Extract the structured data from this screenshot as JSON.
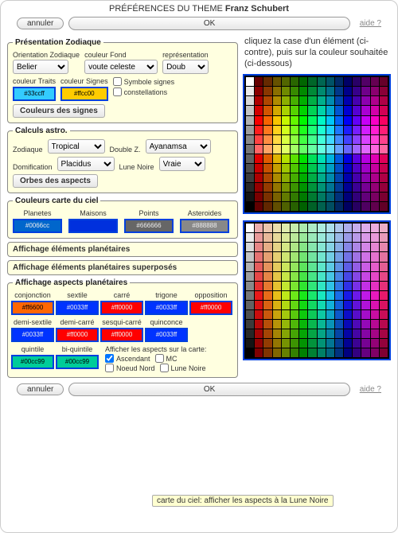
{
  "window_title_prefix": "PRÉFÉRENCES DU THEME",
  "window_title_name": "Franz Schubert",
  "buttons": {
    "cancel": "annuler",
    "ok": "OK",
    "help": "aide ?"
  },
  "zodiac": {
    "legend": "Présentation Zodiaque",
    "orientation_label": "Orientation Zodiaque",
    "orientation_value": "Belier",
    "bgcolor_label": "couleur Fond",
    "bgcolor_value": "voute celeste",
    "repr_label": "représentation",
    "repr_value": "Doub",
    "traits_label": "couleur Traits",
    "traits_hex": "#33ccff",
    "signs_label": "couleur Signes",
    "signs_hex": "#ffcc00",
    "sym_label": "Symbole signes",
    "const_label": "constellations",
    "signs_button": "Couleurs des signes"
  },
  "calc": {
    "legend": "Calculs astro.",
    "zodiac_label": "Zodiaque",
    "zodiac_value": "Tropical",
    "doublez_label": "Double Z.",
    "doublez_value": "Ayanamsa",
    "dom_label": "Domification",
    "dom_value": "Placidus",
    "lune_label": "Lune Noire",
    "lune_value": "Vraie",
    "orbes_button": "Orbes des aspects"
  },
  "sky": {
    "legend": "Couleurs carte du ciel",
    "items": [
      {
        "label": "Planetes",
        "hex": "#0066cc",
        "bg": "#0066cc",
        "dark": true
      },
      {
        "label": "Maisons",
        "hex": "",
        "bg": "#0030dd",
        "dark": true
      },
      {
        "label": "Points",
        "hex": "#666666",
        "bg": "#666666",
        "dark": true
      },
      {
        "label": "Asteroides",
        "hex": "#888888",
        "bg": "#888888",
        "dark": true
      }
    ]
  },
  "banners": {
    "aff_planets": "Affichage éléments planétaires",
    "aff_superposed": "Affichage éléments planétaires superposés"
  },
  "aspects": {
    "legend": "Affichage aspects planétaires",
    "row1": [
      {
        "label": "conjonction",
        "hex": "#ff6600",
        "bg": "#ff6600"
      },
      {
        "label": "sextile",
        "hex": "#0033ff",
        "bg": "#0033ff",
        "dark": true
      },
      {
        "label": "carré",
        "hex": "#ff0000",
        "bg": "#ff0000",
        "dark": true
      },
      {
        "label": "trigone",
        "hex": "#0033ff",
        "bg": "#0033ff",
        "dark": true
      },
      {
        "label": "opposition",
        "hex": "#ff0000",
        "bg": "#ff0000",
        "dark": true
      }
    ],
    "row2": [
      {
        "label": "demi-sextile",
        "hex": "#0033ff",
        "bg": "#0033ff",
        "dark": true
      },
      {
        "label": "demi-carré",
        "hex": "#ff0000",
        "bg": "#ff0000",
        "dark": true
      },
      {
        "label": "sesqui-carré",
        "hex": "#ff0000",
        "bg": "#ff0000",
        "dark": true
      },
      {
        "label": "quinconce",
        "hex": "#0033ff",
        "bg": "#0033ff",
        "dark": true
      }
    ],
    "row3": [
      {
        "label": "quintile",
        "hex": "#00cc99",
        "bg": "#00cc99"
      },
      {
        "label": "bi-quintile",
        "hex": "#00cc99",
        "bg": "#00cc99"
      }
    ],
    "show_label": "Afficher les aspects sur la carte:",
    "cb_asc": "Ascendant",
    "cb_mc": "MC",
    "cb_noeud": "Noeud Nord",
    "cb_lune": "Lune Noire"
  },
  "rightmsg": "cliquez la case d'un élément (ci-contre), puis sur la couleur souhaitée (ci-dessous)",
  "tooltip": "carte du ciel: afficher les aspects à la Lune Noire",
  "palette": {
    "cols": 16,
    "rows": 14
  }
}
